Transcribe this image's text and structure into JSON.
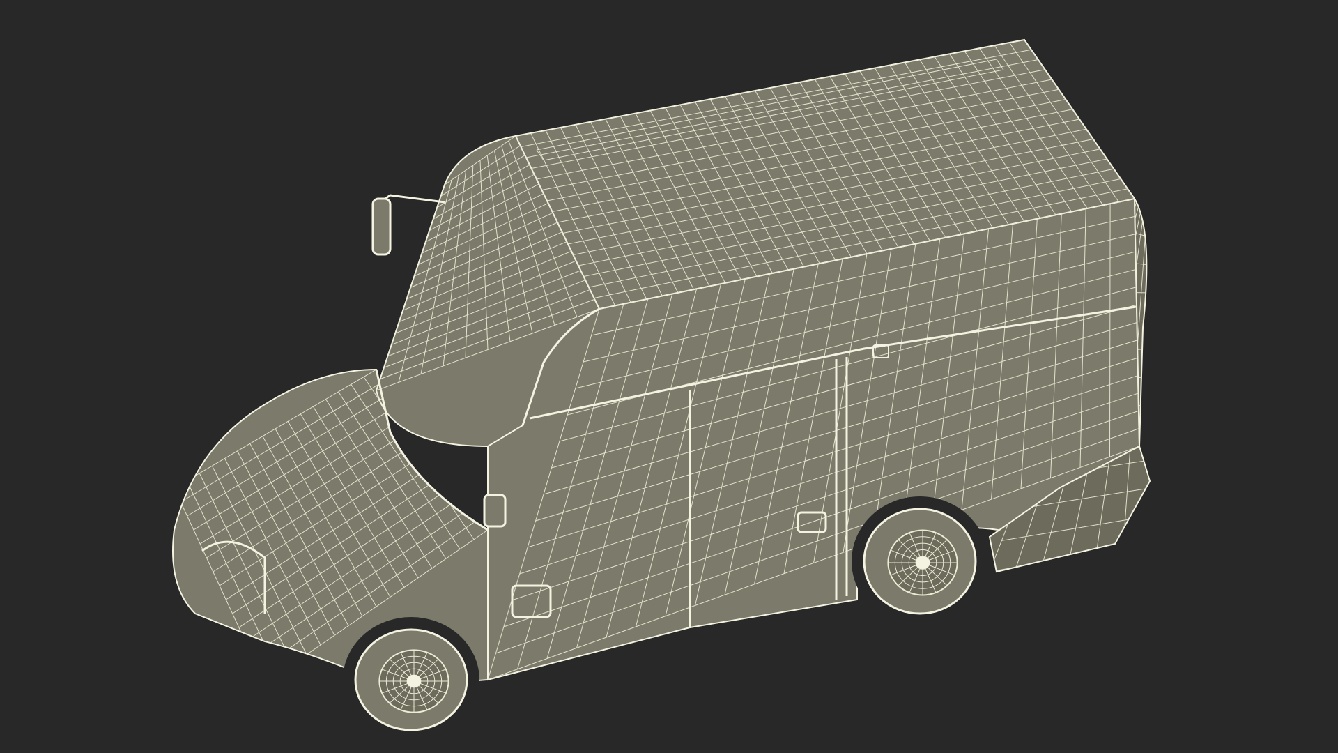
{
  "scene": {
    "subject": "delivery-van-wireframe",
    "background_color": "#282828",
    "surface_color": "#7c7b6b",
    "surface_dark": "#6c6b5c",
    "wire_color": "#ecebd6",
    "edge_color": "#f4f3e2"
  }
}
